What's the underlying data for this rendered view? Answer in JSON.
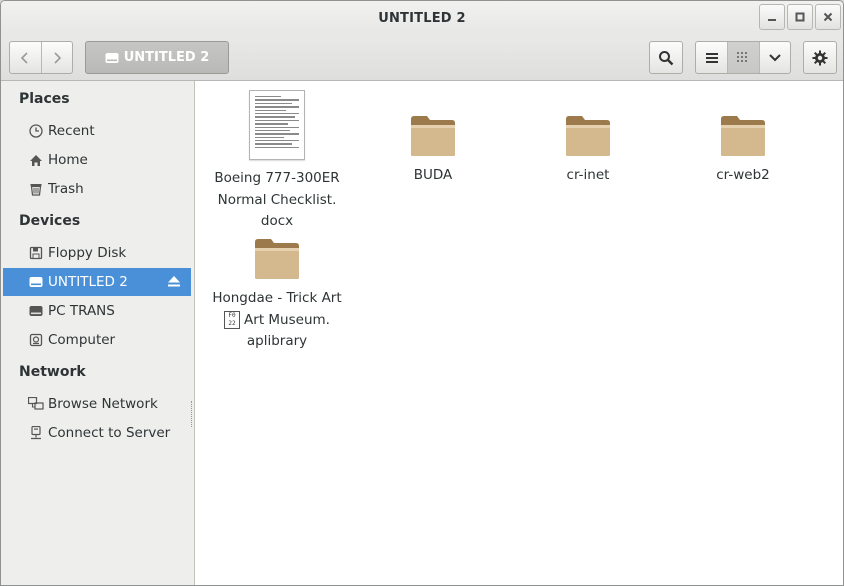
{
  "window": {
    "title": "UNTITLED 2"
  },
  "toolbar": {
    "path_label": "UNTITLED 2",
    "icons": [
      "back-icon",
      "forward-icon",
      "drive-icon",
      "search-icon",
      "list-view-icon",
      "grid-view-icon",
      "chevron-down-icon",
      "gear-icon"
    ]
  },
  "sidebar": {
    "sections": {
      "places": "Places",
      "devices": "Devices",
      "network": "Network"
    },
    "places": [
      {
        "label": "Recent",
        "icon": "clock-icon"
      },
      {
        "label": "Home",
        "icon": "home-icon"
      },
      {
        "label": "Trash",
        "icon": "trash-icon"
      }
    ],
    "devices": [
      {
        "label": "Floppy Disk",
        "icon": "floppy-icon"
      },
      {
        "label": "UNTITLED 2",
        "icon": "drive-icon",
        "selected": true
      },
      {
        "label": "PC TRANS",
        "icon": "drive-icon"
      },
      {
        "label": "Computer",
        "icon": "computer-icon"
      }
    ],
    "network": [
      {
        "label": "Browse Network",
        "icon": "network-icon"
      },
      {
        "label": "Connect to Server",
        "icon": "server-icon"
      }
    ]
  },
  "files": [
    {
      "name_lines": [
        "Boeing 777-300ER",
        "Normal Checklist.",
        "docx"
      ],
      "type": "document"
    },
    {
      "name_lines": [
        "BUDA"
      ],
      "type": "folder"
    },
    {
      "name_lines": [
        "cr-inet"
      ],
      "type": "folder"
    },
    {
      "name_lines": [
        "cr-web2"
      ],
      "type": "folder"
    },
    {
      "name_lines": [
        "Hongdae - Trick Art",
        "Art Museum.",
        "aplibrary"
      ],
      "name_glyph": "F022",
      "type": "folder"
    }
  ],
  "colors": {
    "accent": "#4a90d9",
    "folder": "#c8a97a",
    "sidebar_bg": "#eeeeec"
  }
}
